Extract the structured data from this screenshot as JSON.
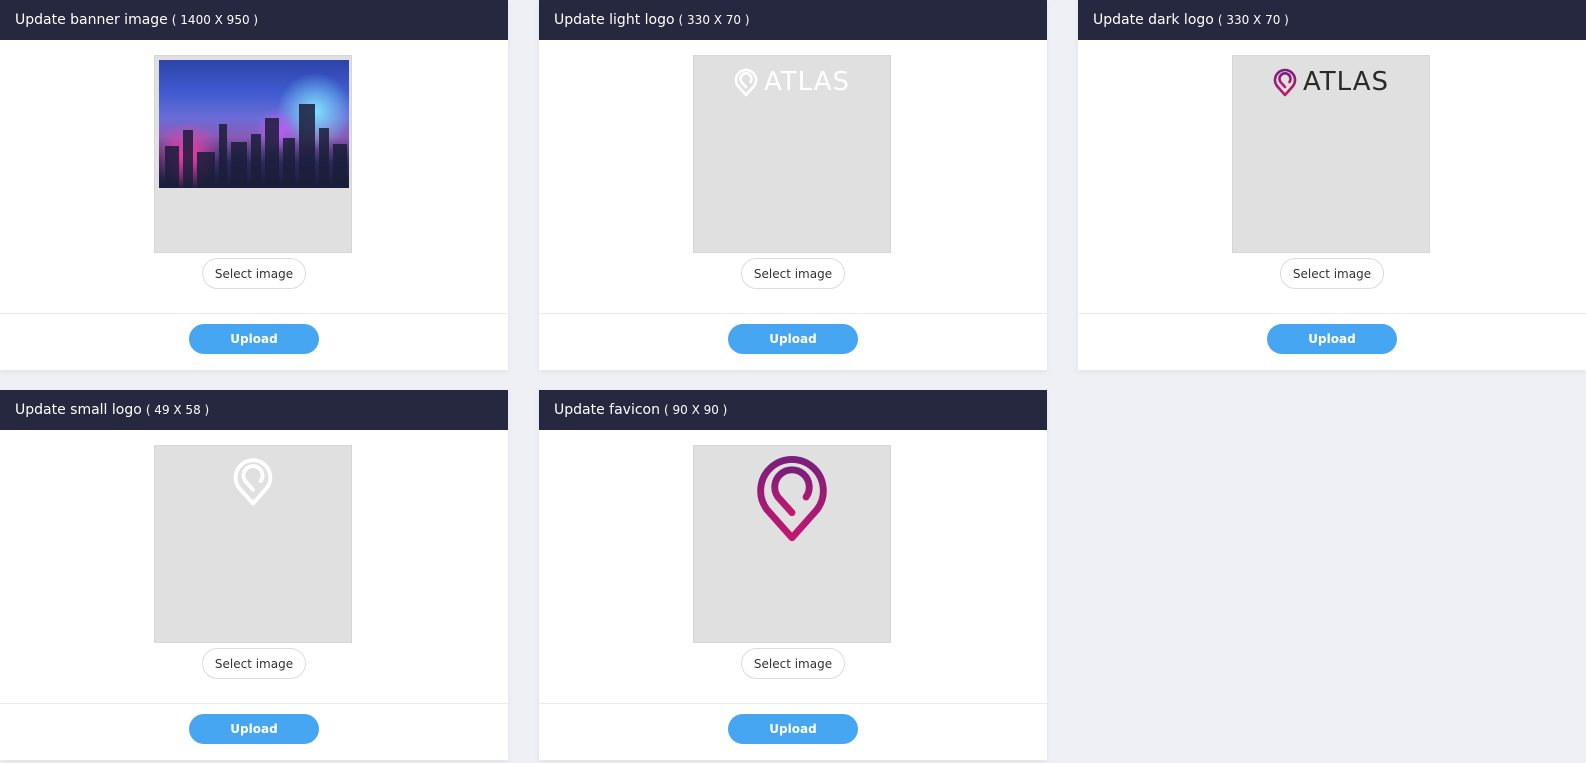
{
  "cards": {
    "banner": {
      "title": "Update banner image",
      "dims": "( 1400 X 950 )",
      "select_label": "Select image",
      "upload_label": "Upload"
    },
    "light_logo": {
      "title": "Update light logo",
      "dims": "( 330 X 70 )",
      "select_label": "Select image",
      "upload_label": "Upload",
      "logo_text": "ATLAS"
    },
    "dark_logo": {
      "title": "Update dark logo",
      "dims": "( 330 X 70 )",
      "select_label": "Select image",
      "upload_label": "Upload",
      "logo_text": "ATLAS"
    },
    "small_logo": {
      "title": "Update small logo",
      "dims": "( 49 X 58 )",
      "select_label": "Select image",
      "upload_label": "Upload"
    },
    "favicon": {
      "title": "Update favicon",
      "dims": "( 90 X 90 )",
      "select_label": "Select image",
      "upload_label": "Upload"
    }
  },
  "colors": {
    "header_bg": "#262840",
    "upload_button": "#46a6f2",
    "page_bg": "#eef0f6",
    "preview_bg": "#e0e0e0",
    "logo_pink": "#b0206e",
    "logo_purple": "#7a1f7a"
  },
  "icons": {
    "logo_mark": "map-pin-icon"
  }
}
